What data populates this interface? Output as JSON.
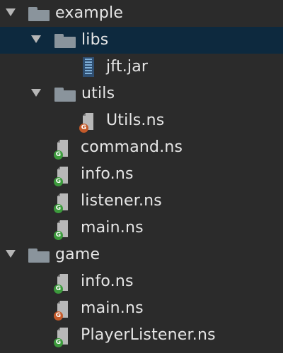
{
  "colors": {
    "background": "#2b2b2b",
    "selection": "#0d293e",
    "text": "#e6e6e6",
    "badge_green": "#3c9a3c",
    "badge_orange": "#c45a2a"
  },
  "tree": [
    {
      "label": "example",
      "kind": "folder",
      "expanded": true,
      "icon": "folder-icon"
    },
    {
      "label": "libs",
      "kind": "folder",
      "expanded": true,
      "selected": true,
      "icon": "folder-icon"
    },
    {
      "label": "jft.jar",
      "kind": "jar",
      "icon": "jar-file-icon"
    },
    {
      "label": "utils",
      "kind": "folder",
      "expanded": true,
      "icon": "folder-icon"
    },
    {
      "label": "Utils.ns",
      "kind": "file",
      "badge": "G",
      "badge_color": "orange",
      "icon": "ns-file-icon"
    },
    {
      "label": "command.ns",
      "kind": "file",
      "badge": "G",
      "badge_color": "green",
      "icon": "ns-file-icon"
    },
    {
      "label": "info.ns",
      "kind": "file",
      "badge": "G",
      "badge_color": "green",
      "icon": "ns-file-icon"
    },
    {
      "label": "listener.ns",
      "kind": "file",
      "badge": "G",
      "badge_color": "green",
      "icon": "ns-file-icon"
    },
    {
      "label": "main.ns",
      "kind": "file",
      "badge": "G",
      "badge_color": "green",
      "icon": "ns-file-icon"
    },
    {
      "label": "game",
      "kind": "folder",
      "expanded": true,
      "icon": "folder-icon"
    },
    {
      "label": "info.ns",
      "kind": "file",
      "badge": "G",
      "badge_color": "green",
      "icon": "ns-file-icon"
    },
    {
      "label": "main.ns",
      "kind": "file",
      "badge": "G",
      "badge_color": "orange",
      "icon": "ns-file-icon"
    },
    {
      "label": "PlayerListener.ns",
      "kind": "file",
      "badge": "G",
      "badge_color": "green",
      "icon": "ns-file-icon"
    }
  ]
}
